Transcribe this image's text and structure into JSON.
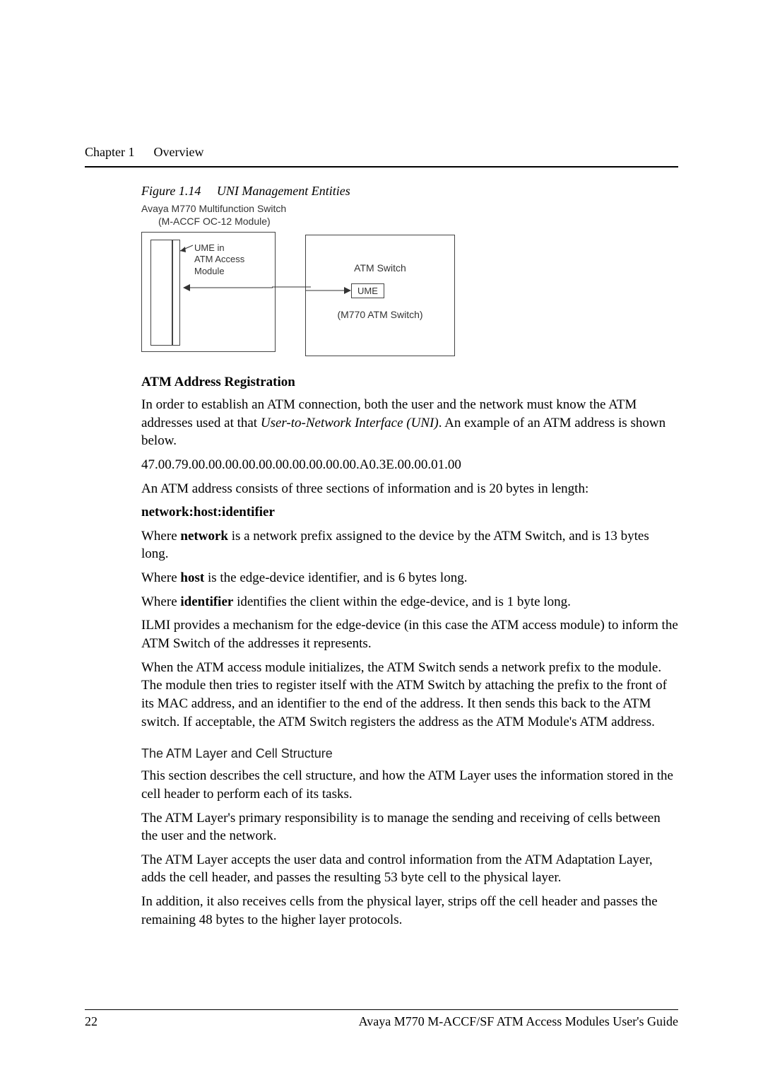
{
  "header": {
    "chapter": "Chapter 1",
    "title": "Overview"
  },
  "figure": {
    "caption_num": "Figure 1.14",
    "caption_text": "UNI Management Entities",
    "top_line1": "Avaya M770 Multifunction Switch",
    "top_line2": "(M-ACCF OC-12 Module)",
    "left_l1": "UME in",
    "left_l2": "ATM Access",
    "left_l3": "Module",
    "right_title": "ATM Switch",
    "right_ume": "UME",
    "right_sub": "(M770 ATM Switch)"
  },
  "section1": {
    "title": "ATM Address Registration",
    "p1a": "In order to establish an ATM connection, both the user and the network must know the ATM addresses used at that ",
    "p1_ital": "User-to-Network Interface (UNI)",
    "p1b": ". An example of an ATM address is shown below.",
    "addr": "47.00.79.00.00.00.00.00.00.00.00.00.00.A0.3E.00.00.01.00",
    "p2": "An ATM address consists of three sections of information and is 20 bytes in length:",
    "nhi": "network:host:identifier",
    "p3a": "Where ",
    "p3b": "network",
    "p3c": " is a network prefix assigned to the device by the ATM Switch, and is 13 bytes long.",
    "p4a": "Where ",
    "p4b": "host",
    "p4c": " is the edge-device identifier, and is 6 bytes long.",
    "p5a": "Where ",
    "p5b": "identifier",
    "p5c": " identifies the client within the edge-device, and is 1 byte long.",
    "p6": "ILMI provides a mechanism for the edge-device (in this case the ATM access module) to inform the ATM Switch of the addresses it represents.",
    "p7": "When the ATM access module initializes, the ATM Switch sends a network prefix to the module. The module then tries to register itself with the ATM Switch by attaching the prefix to the front of its MAC address, and an identifier to the end of the address. It then sends this back to the ATM switch. If acceptable, the ATM Switch registers the address as the ATM Module's ATM address."
  },
  "section2": {
    "title": "The ATM Layer and Cell Structure",
    "p1": "This section describes the cell structure, and how the ATM Layer uses the information stored in the cell header to perform each of its tasks.",
    "p2": "The ATM Layer's primary responsibility is to manage the sending and receiving of cells between the user and the network.",
    "p3": "The ATM Layer accepts the user data and control information from the ATM Adaptation Layer, adds the cell header, and passes the resulting 53 byte cell to the physical layer.",
    "p4": "In addition, it also receives cells from the physical layer, strips off the cell header and passes the remaining 48 bytes to the higher layer protocols."
  },
  "footer": {
    "page": "22",
    "guide": "Avaya M770 M-ACCF/SF ATM Access Modules User's Guide"
  }
}
